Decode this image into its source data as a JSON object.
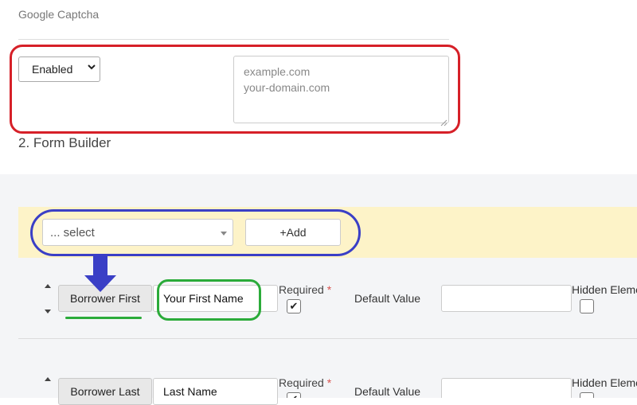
{
  "captcha": {
    "title": "Google Captcha",
    "status_value": "Enabled",
    "domains_lines": [
      "example.com",
      "your-domain.com"
    ]
  },
  "form_builder": {
    "title": "2. Form Builder",
    "field_select_placeholder": "... select",
    "add_label": "+Add",
    "rows": [
      {
        "field": "Borrower First",
        "label_value": "Your First Name",
        "required_label": "Required",
        "required_star": "*",
        "required_checked": true,
        "required_mark": "✔",
        "default_label": "Default Value",
        "default_value": "",
        "hidden_label": "Hidden Eleme",
        "hidden_checked": false
      },
      {
        "field": "Borrower Last",
        "label_value": "Last Name",
        "required_label": "Required",
        "required_star": "*",
        "required_checked": true,
        "required_mark": "✔",
        "default_label": "Default Value",
        "default_value": "",
        "hidden_label": "Hidden Eleme",
        "hidden_checked": false
      }
    ]
  },
  "colors": {
    "annotation_red": "#d62028",
    "annotation_blue": "#3a3fc6",
    "annotation_green": "#2bab3a",
    "highlight_bar": "#fdf3c8"
  }
}
